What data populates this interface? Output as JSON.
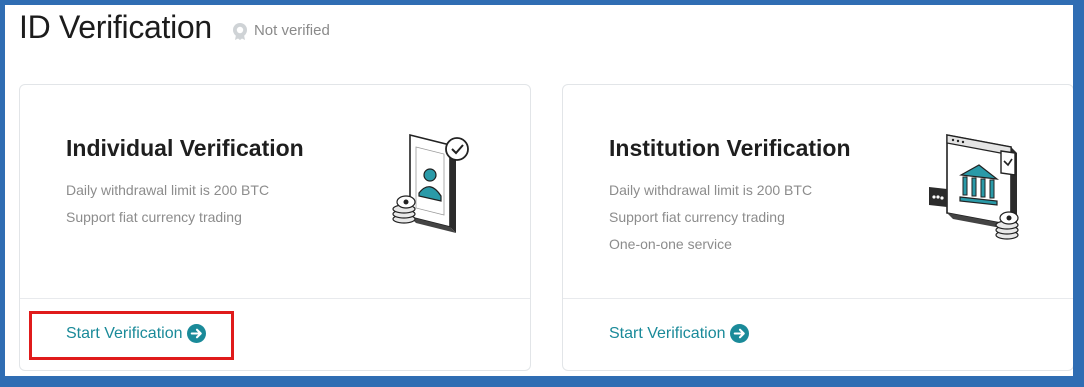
{
  "header": {
    "title": "ID Verification",
    "status_text": "Not verified",
    "status_icon": "badge-icon"
  },
  "cards": [
    {
      "title": "Individual Verification",
      "features": [
        "Daily withdrawal limit is 200 BTC",
        "Support fiat currency trading"
      ],
      "action_label": "Start Verification",
      "illustration": "phone-user-icon"
    },
    {
      "title": "Institution Verification",
      "features": [
        "Daily withdrawal limit is 200 BTC",
        "Support fiat currency trading",
        "One-on-one service"
      ],
      "action_label": "Start Verification",
      "illustration": "bank-building-icon"
    }
  ],
  "colors": {
    "accent": "#1a8a99",
    "highlight": "#e01b1b",
    "frame": "#2f6db3"
  }
}
